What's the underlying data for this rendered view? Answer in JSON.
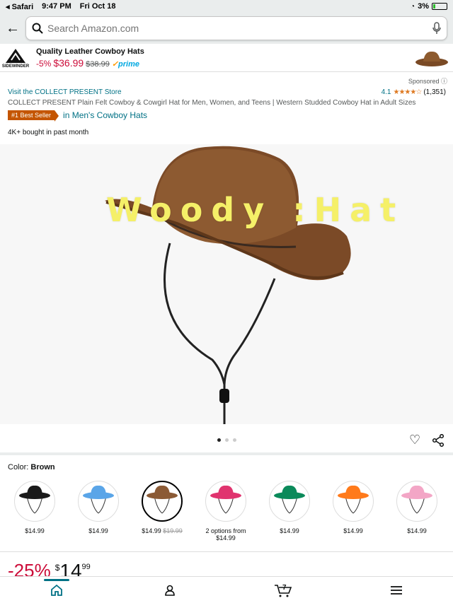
{
  "status": {
    "carrier": "◂ Safari",
    "time": "9:47 PM",
    "date": "Fri Oct 18",
    "battery": "3%"
  },
  "search": {
    "placeholder": "Search Amazon.com"
  },
  "ad": {
    "brand": "SIDEWINDER",
    "title": "Quality Leather Cowboy Hats",
    "discount": "-5%",
    "price": "$36.99",
    "list_price": "$38.99",
    "prime": "prime"
  },
  "sponsored": "Sponsored",
  "product": {
    "store_link": "Visit the COLLECT PRESENT Store",
    "rating": "4.1",
    "stars": "★★★★☆",
    "review_count": "(1,351)",
    "title": "COLLECT PRESENT Plain Felt Cowboy & Cowgirl Hat for Men, Women, and Teens | Western Studded Cowboy Hat in Adult Sizes",
    "best_seller_badge": "#1 Best Seller",
    "best_seller_category": "in Men's Cowboy Hats",
    "bought": "4K+ bought in past month",
    "overlay_text": "Woody :Hat"
  },
  "color": {
    "label": "Color: ",
    "selected": "Brown"
  },
  "swatches": [
    {
      "color": "#1a1a1a",
      "price": "$14.99",
      "old": ""
    },
    {
      "color": "#5aa5e8",
      "price": "$14.99",
      "old": ""
    },
    {
      "color": "#8b5a35",
      "price": "$14.99",
      "old": "$19.99"
    },
    {
      "color": "#e0346f",
      "price": "2 options from",
      "price2": "$14.99",
      "old": ""
    },
    {
      "color": "#0b8a5a",
      "price": "$14.99",
      "old": ""
    },
    {
      "color": "#ff7a1a",
      "price": "$14.99",
      "old": ""
    },
    {
      "color": "#f3a6c6",
      "price": "$14.99",
      "old": ""
    }
  ],
  "price": {
    "discount": "-25%",
    "currency": "$",
    "whole": "14",
    "fraction": "99"
  },
  "colors": {
    "accent": "#007185",
    "deal": "#cc0c39",
    "badge": "#c45500",
    "star": "#de7921"
  }
}
